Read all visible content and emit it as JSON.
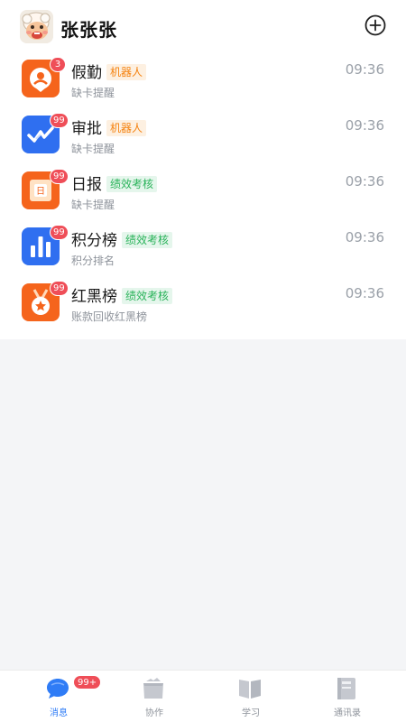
{
  "header": {
    "user_name": "张张张",
    "add_icon": "plus-circle-icon"
  },
  "messages": [
    {
      "title": "假勤",
      "tag": "机器人",
      "tag_color": "#f5820f",
      "time": "09:36",
      "subtitle": "缺卡提醒",
      "badge": "3",
      "icon": "attendance-icon",
      "icon_bg": "#f5641c"
    },
    {
      "title": "审批",
      "tag": "机器人",
      "tag_color": "#f5820f",
      "time": "09:36",
      "subtitle": "缺卡提醒",
      "badge": "99",
      "icon": "approval-icon",
      "icon_bg": "#2f6ff0"
    },
    {
      "title": "日报",
      "tag": "绩效考核",
      "tag_color": "#2ab35a",
      "time": "09:36",
      "subtitle": "缺卡提醒",
      "badge": "99",
      "icon": "daily-report-icon",
      "icon_bg": "#f5641c"
    },
    {
      "title": "积分榜",
      "tag": "绩效考核",
      "tag_color": "#2ab35a",
      "time": "09:36",
      "subtitle": "积分排名",
      "badge": "99",
      "icon": "bar-chart-icon",
      "icon_bg": "#2f6ff0"
    },
    {
      "title": "红黑榜",
      "tag": "绩效考核",
      "tag_color": "#2ab35a",
      "time": "09:36",
      "subtitle": "账款回收红黑榜",
      "badge": "99",
      "icon": "medal-icon",
      "icon_bg": "#f5641c"
    }
  ],
  "tabbar": {
    "tabs": [
      {
        "label": "消息",
        "icon": "chat-bubble-icon",
        "active": true,
        "badge": "99+"
      },
      {
        "label": "协作",
        "icon": "folder-icon",
        "active": false
      },
      {
        "label": "学习",
        "icon": "book-icon",
        "active": false
      },
      {
        "label": "通讯录",
        "icon": "contacts-book-icon",
        "active": false
      }
    ]
  },
  "colors": {
    "accent": "#2f7cf6",
    "badge": "#ef4e58",
    "orange_icon": "#f5641c",
    "blue_icon": "#2f6ff0"
  }
}
